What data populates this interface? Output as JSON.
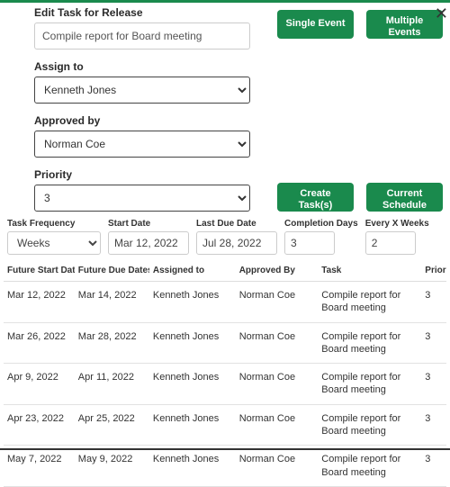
{
  "header": {
    "title": "Edit Task for Release",
    "task_name": "Compile report for Board meeting"
  },
  "buttons": {
    "single_event": "Single Event",
    "multiple_events": "Multiple Events",
    "create_tasks": "Create Task(s)",
    "current_schedule": "Current Schedule"
  },
  "fields": {
    "assign_label": "Assign to",
    "assign_value": "Kenneth Jones",
    "approved_label": "Approved by",
    "approved_value": "Norman Coe",
    "priority_label": "Priority",
    "priority_value": "3"
  },
  "params": {
    "freq_label": "Task Frequency",
    "freq_value": "Weeks",
    "start_label": "Start Date",
    "start_value": "Mar 12, 2022",
    "last_label": "Last Due Date",
    "last_value": "Jul 28, 2022",
    "comp_label": "Completion Days",
    "comp_value": "3",
    "every_label": "Every X Weeks",
    "every_value": "2"
  },
  "table": {
    "headers": {
      "start": "Future Start Dates",
      "due": "Future Due Dates",
      "assigned": "Assigned to",
      "approved": "Approved By",
      "task": "Task",
      "priority": "Prior"
    },
    "rows": [
      {
        "start": "Mar 12, 2022",
        "due": "Mar 14, 2022",
        "assigned": "Kenneth Jones",
        "approved": "Norman Coe",
        "task": "Compile report for Board meeting",
        "priority": "3"
      },
      {
        "start": "Mar 26, 2022",
        "due": "Mar 28, 2022",
        "assigned": "Kenneth Jones",
        "approved": "Norman Coe",
        "task": "Compile report for Board meeting",
        "priority": "3"
      },
      {
        "start": "Apr 9, 2022",
        "due": "Apr 11, 2022",
        "assigned": "Kenneth Jones",
        "approved": "Norman Coe",
        "task": "Compile report for Board meeting",
        "priority": "3"
      },
      {
        "start": "Apr 23, 2022",
        "due": "Apr 25, 2022",
        "assigned": "Kenneth Jones",
        "approved": "Norman Coe",
        "task": "Compile report for Board meeting",
        "priority": "3"
      },
      {
        "start": "May 7, 2022",
        "due": "May 9, 2022",
        "assigned": "Kenneth Jones",
        "approved": "Norman Coe",
        "task": "Compile report for Board meeting",
        "priority": "3"
      }
    ]
  }
}
